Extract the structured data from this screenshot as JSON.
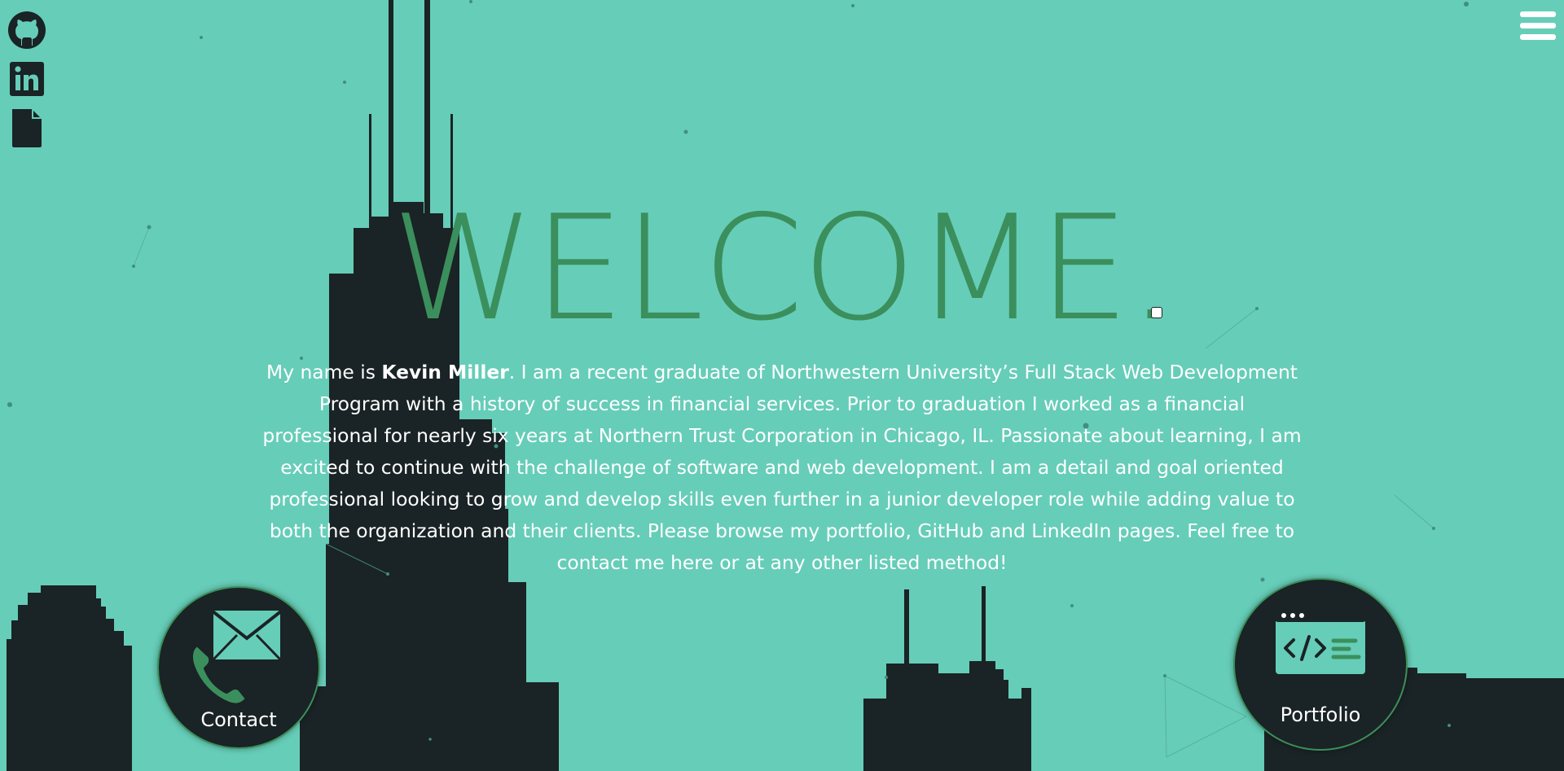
{
  "nav": {
    "github_icon": "github-icon",
    "linkedin_icon": "linkedin-icon",
    "resume_icon": "document-icon",
    "menu_icon": "hamburger-menu-icon"
  },
  "hero": {
    "title": "WELCOME.",
    "bio_prefix": "My name is ",
    "bio_name": "Kevin Miller",
    "bio_rest": ". I am a recent graduate of Northwestern University’s Full Stack Web Development Program with a history of success in financial services. Prior to graduation I worked as a financial professional for nearly six years at Northern Trust Corporation in Chicago, IL. Passionate about learning, I am excited to continue with the challenge of software and web development. I am a detail and goal oriented professional looking to grow and develop skills even further in a junior developer role while adding value to both the organization and their clients. Please browse my portfolio, GitHub and LinkedIn pages. Feel free to contact me here or at any other listed method!"
  },
  "buttons": {
    "contact_label": "Contact",
    "portfolio_label": "Portfolio"
  },
  "colors": {
    "background": "#66cdb8",
    "skyline": "#1a2325",
    "accent": "#3b8f5c",
    "text": "#ffffff"
  }
}
